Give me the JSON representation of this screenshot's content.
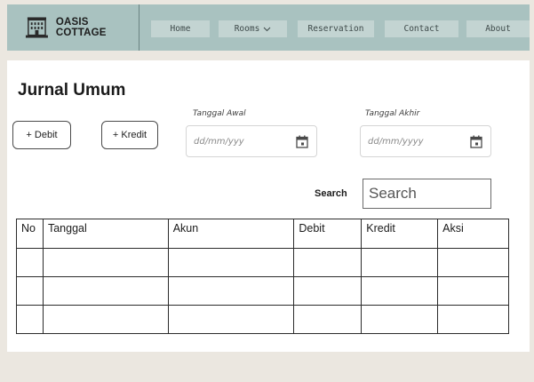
{
  "brand": {
    "name": "OASIS COTTAGE",
    "logo_icon": "building-icon"
  },
  "nav": [
    {
      "label": "Home"
    },
    {
      "label": "Rooms",
      "dropdown": true
    },
    {
      "label": "Reservation"
    },
    {
      "label": "Contact"
    },
    {
      "label": "About"
    }
  ],
  "page": {
    "title": "Jurnal Umum"
  },
  "buttons": {
    "debit": "+ Debit",
    "kredit": "+ Kredit"
  },
  "filters": {
    "start_label": "Tanggal Awal",
    "start_placeholder": "dd/mm/yyy",
    "end_label": "Tanggal Akhir",
    "end_placeholder": "dd/mm/yyyy"
  },
  "search": {
    "label": "Search",
    "placeholder": "Search"
  },
  "table": {
    "headers": [
      "No",
      "Tanggal",
      "Akun",
      "Debit",
      "Kredit",
      "Aksi"
    ],
    "rows": [
      [
        "",
        "",
        "",
        "",
        "",
        ""
      ],
      [
        "",
        "",
        "",
        "",
        "",
        ""
      ],
      [
        "",
        "",
        "",
        "",
        "",
        ""
      ]
    ]
  },
  "colors": {
    "navbar": "#a9c2c0",
    "nav_button": "#c3d4d2",
    "background": "#ebe7e0"
  }
}
